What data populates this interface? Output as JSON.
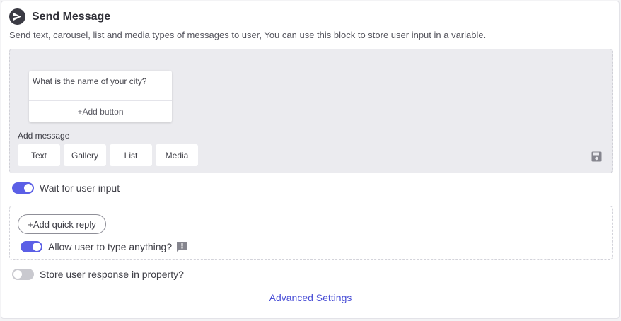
{
  "header": {
    "title": "Send Message",
    "icon": "send-icon",
    "subtitle": "Send text, carousel, list and media types of messages to user, You can use this block to store user input in a variable."
  },
  "message_area": {
    "card": {
      "text": "What is the name of your city?",
      "add_button_label": "+Add button"
    },
    "add_message_label": "Add message",
    "type_buttons": [
      "Text",
      "Gallery",
      "List",
      "Media"
    ],
    "save_icon": "floppy-disk-icon"
  },
  "wait_for_input": {
    "label": "Wait for user input",
    "enabled": true
  },
  "quick_reply": {
    "button_label": "+Add quick reply",
    "allow_typing": {
      "label": "Allow user to type anything?",
      "enabled": true,
      "info_icon": "chat-bubble-icon"
    }
  },
  "store_response": {
    "label": "Store user response in property?",
    "enabled": false
  },
  "advanced_settings_label": "Advanced Settings",
  "colors": {
    "accent": "#5b5fe6",
    "link": "#4a4fd6",
    "toggle_off": "#c9c9cf",
    "message_area_bg": "#ebebef"
  }
}
